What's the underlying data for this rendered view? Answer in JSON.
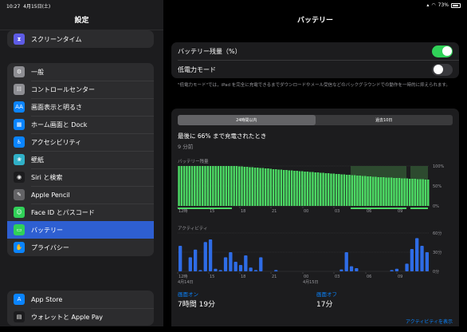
{
  "status": {
    "time": "10:27",
    "date": "4月15日(土)",
    "battery": "73%"
  },
  "sidebar": {
    "title": "設定",
    "items": [
      {
        "label": "スクリーンタイム",
        "icon": "hourglass-icon",
        "color": "#5e5ce6",
        "glyph": "⧗"
      },
      {
        "label": "一般",
        "icon": "gear-icon",
        "color": "#8e8e93",
        "glyph": "⚙"
      },
      {
        "label": "コントロールセンター",
        "icon": "switches-icon",
        "color": "#8e8e93",
        "glyph": "☷"
      },
      {
        "label": "画面表示と明るさ",
        "icon": "text-size-icon",
        "color": "#0a84ff",
        "glyph": "AA"
      },
      {
        "label": "ホーム画面と Dock",
        "icon": "grid-icon",
        "color": "#0a84ff",
        "glyph": "▦"
      },
      {
        "label": "アクセシビリティ",
        "icon": "accessibility-icon",
        "color": "#0a84ff",
        "glyph": "♿"
      },
      {
        "label": "壁紙",
        "icon": "wallpaper-icon",
        "color": "#30b0c7",
        "glyph": "❀"
      },
      {
        "label": "Siri と検索",
        "icon": "siri-icon",
        "color": "#1c1c1e",
        "glyph": "◉"
      },
      {
        "label": "Apple Pencil",
        "icon": "pencil-icon",
        "color": "#636366",
        "glyph": "✎"
      },
      {
        "label": "Face ID とパスコード",
        "icon": "face-id-icon",
        "color": "#30d158",
        "glyph": "☺"
      },
      {
        "label": "バッテリー",
        "icon": "battery-icon",
        "color": "#30d158",
        "glyph": "▭"
      },
      {
        "label": "プライバシー",
        "icon": "hand-icon",
        "color": "#0a84ff",
        "glyph": "✋"
      },
      {
        "label": "App Store",
        "icon": "app-store-icon",
        "color": "#0a84ff",
        "glyph": "A"
      },
      {
        "label": "ウォレットと Apple Pay",
        "icon": "wallet-icon",
        "color": "#1c1c1e",
        "glyph": "▤"
      }
    ]
  },
  "main": {
    "title": "バッテリー",
    "battery_percentage": "バッテリー残量（%）",
    "low_power": "低電力モード",
    "note": "\"低電力モード\"では，iPad を完全に充電できるまでダウンロードやメール受信などのバックグラウンドでの動作を一時的に抑えられます。",
    "seg_24h": "24時間以内",
    "seg_10d": "過去10日",
    "last_charged": "最後に 66% まで充電されたとき",
    "last_charged_ago": "9 分前",
    "level_label": "バッテリー残量",
    "activity_label": "アクティビティ",
    "y_level": [
      "100%",
      "50%",
      "0%"
    ],
    "y_activity": [
      "60分",
      "30分",
      "0分"
    ],
    "x_ticks": [
      "12時",
      "15",
      "18",
      "21",
      "00",
      "03",
      "06",
      "09"
    ],
    "date_1": "4月14日",
    "date_2": "4月15日",
    "screen_on_label": "画面オン",
    "screen_on_value": "7時間 19分",
    "screen_off_label": "画面オフ",
    "screen_off_value": "17分",
    "show_activity": "アクティビティを表示"
  },
  "chart_data": [
    {
      "type": "bar",
      "title": "バッテリー残量",
      "ylim": [
        0,
        100
      ],
      "x_ticks": [
        "12時",
        "15",
        "18",
        "21",
        "00",
        "03",
        "06",
        "09"
      ],
      "values": [
        100,
        100,
        100,
        100,
        100,
        100,
        100,
        100,
        100,
        100,
        100,
        100,
        100,
        100,
        100,
        100,
        100,
        100,
        100,
        100,
        100,
        100,
        100,
        99,
        99,
        98,
        98,
        97,
        97,
        96,
        96,
        95,
        95,
        94,
        94,
        93,
        92,
        92,
        91,
        91,
        90,
        90,
        89,
        89,
        88,
        88,
        87,
        87,
        86,
        86,
        85,
        85,
        84,
        84,
        83,
        83,
        82,
        82,
        81,
        81,
        80,
        80,
        79,
        79,
        78,
        78,
        77,
        77,
        76,
        76,
        75,
        75,
        74,
        74,
        73,
        73,
        72,
        72,
        72,
        71,
        71,
        71,
        70,
        70,
        70,
        69,
        69,
        69,
        68,
        68,
        68,
        67,
        67,
        67,
        66,
        66
      ]
    },
    {
      "type": "bar",
      "title": "アクティビティ",
      "ylim": [
        0,
        60
      ],
      "x_ticks": [
        "12時",
        "15",
        "18",
        "21",
        "00",
        "03",
        "06",
        "09"
      ],
      "values": [
        40,
        0,
        22,
        34,
        2,
        46,
        50,
        4,
        2,
        22,
        30,
        15,
        10,
        25,
        6,
        2,
        22,
        0,
        0,
        2,
        0,
        0,
        0,
        0,
        0,
        0,
        0,
        0,
        0,
        0,
        0,
        0,
        3,
        30,
        8,
        5,
        0,
        0,
        0,
        0,
        0,
        0,
        2,
        4,
        0,
        12,
        35,
        52,
        40,
        30
      ]
    }
  ]
}
